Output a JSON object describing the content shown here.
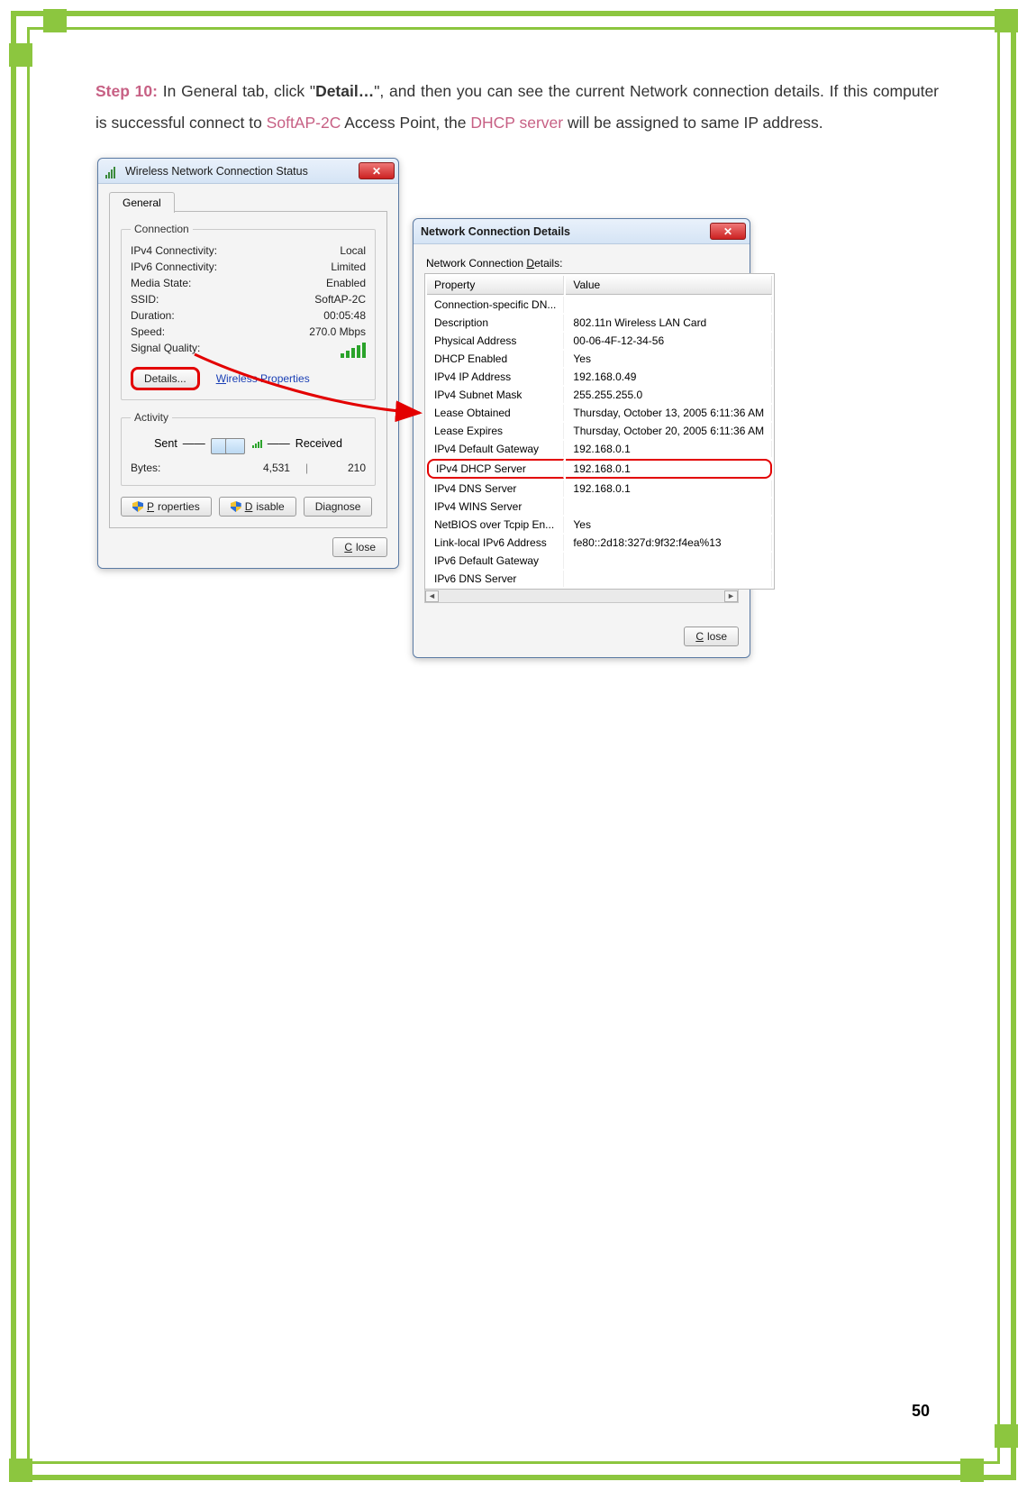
{
  "page_number": "50",
  "instruction": {
    "step_label": "Step 10:",
    "part1": " In General tab, click \"",
    "detail": "Detail…",
    "part2": "\", and then you can see the current Network connection details. If this computer is successful connect to ",
    "softap": "SoftAP-2C",
    "part3": " Access Point, the ",
    "dhcp": "DHCP server",
    "part4": " will be assigned to same IP address."
  },
  "status_win": {
    "title": "Wireless Network Connection Status",
    "tab": "General",
    "group_connection": "Connection",
    "rows": [
      {
        "k": "IPv4 Connectivity:",
        "v": "Local"
      },
      {
        "k": "IPv6 Connectivity:",
        "v": "Limited"
      },
      {
        "k": "Media State:",
        "v": "Enabled"
      },
      {
        "k": "SSID:",
        "v": "SoftAP-2C"
      },
      {
        "k": "Duration:",
        "v": "00:05:48"
      },
      {
        "k": "Speed:",
        "v": "270.0 Mbps"
      }
    ],
    "signal_label": "Signal Quality:",
    "details_btn": "Details...",
    "wprops_link": "Wireless Properties",
    "group_activity": "Activity",
    "sent_label": "Sent",
    "recv_label": "Received",
    "bytes_label": "Bytes:",
    "bytes_sent": "4,531",
    "bytes_recv": "210",
    "btn_properties": "Properties",
    "btn_disable": "Disable",
    "btn_diagnose": "Diagnose",
    "btn_close": "Close"
  },
  "details_win": {
    "title": "Network Connection Details",
    "sub_label": "Network Connection Details:",
    "col_property": "Property",
    "col_value": "Value",
    "rows": [
      {
        "p": "Connection-specific DN...",
        "v": ""
      },
      {
        "p": "Description",
        "v": "802.11n Wireless LAN Card"
      },
      {
        "p": "Physical Address",
        "v": "00-06-4F-12-34-56"
      },
      {
        "p": "DHCP Enabled",
        "v": "Yes"
      },
      {
        "p": "IPv4 IP Address",
        "v": "192.168.0.49"
      },
      {
        "p": "IPv4 Subnet Mask",
        "v": "255.255.255.0"
      },
      {
        "p": "Lease Obtained",
        "v": "Thursday, October 13, 2005 6:11:36 AM"
      },
      {
        "p": "Lease Expires",
        "v": "Thursday, October 20, 2005 6:11:36 AM"
      },
      {
        "p": "IPv4 Default Gateway",
        "v": "192.168.0.1"
      },
      {
        "p": "IPv4 DHCP Server",
        "v": "192.168.0.1",
        "highlight": true
      },
      {
        "p": "IPv4 DNS Server",
        "v": "192.168.0.1"
      },
      {
        "p": "IPv4 WINS Server",
        "v": ""
      },
      {
        "p": "NetBIOS over Tcpip En...",
        "v": "Yes"
      },
      {
        "p": "Link-local IPv6 Address",
        "v": "fe80::2d18:327d:9f32:f4ea%13"
      },
      {
        "p": "IPv6 Default Gateway",
        "v": ""
      },
      {
        "p": "IPv6 DNS Server",
        "v": ""
      }
    ],
    "btn_close": "Close"
  }
}
